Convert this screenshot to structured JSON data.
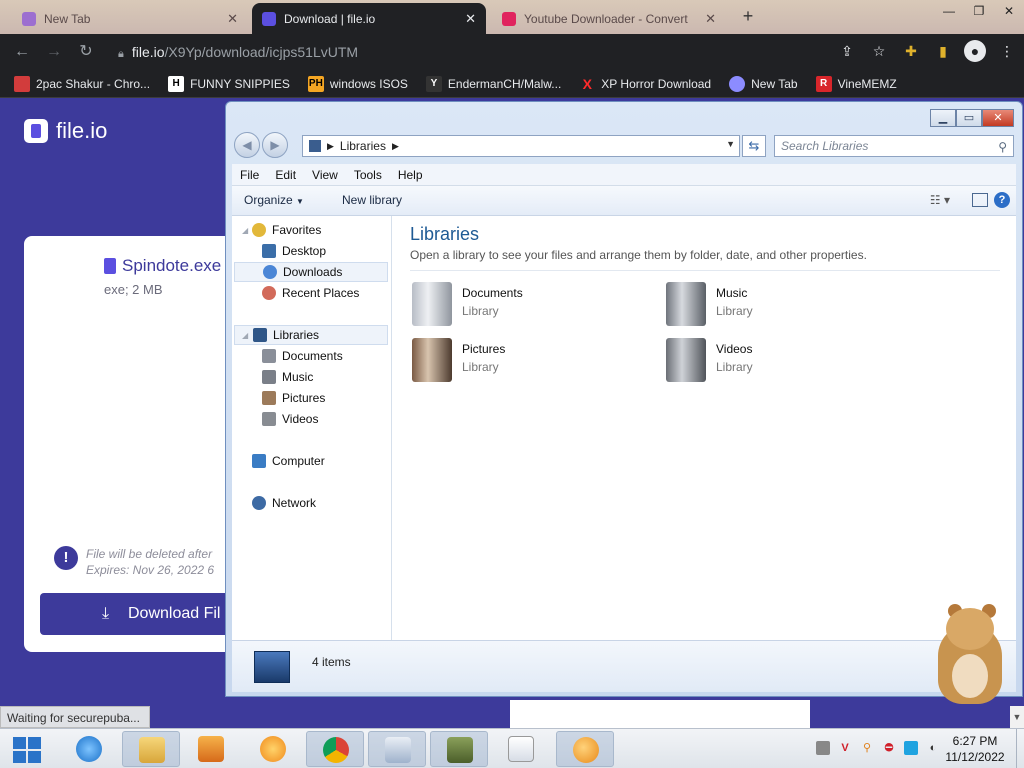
{
  "browser": {
    "tabs": [
      {
        "title": "New Tab",
        "favicon_color": "#9c6fd0"
      },
      {
        "title": "Download | file.io",
        "favicon_color": "#5b4fe0"
      },
      {
        "title": "Youtube Downloader - Convert",
        "favicon_color": "#e0245e"
      }
    ],
    "new_tab_label": "+",
    "url_host": "file.io",
    "url_path": "/X9Yp/download/icjps51LvUTM",
    "bookmarks": [
      {
        "label": "2pac Shakur - Chro...",
        "icon_text": "",
        "color": "#d23c3c"
      },
      {
        "label": "FUNNY SNIPPIES",
        "icon_text": "H",
        "color": "#ffffff"
      },
      {
        "label": "windows ISOS",
        "icon_text": "PH",
        "color": "#f5a623"
      },
      {
        "label": "EndermanCH/Malw...",
        "icon_text": "Y",
        "color": "#333333"
      },
      {
        "label": "XP Horror Download",
        "icon_text": "X",
        "color": "#ff2b2b"
      },
      {
        "label": "New Tab",
        "icon_text": "",
        "color": "#8c8cff"
      },
      {
        "label": "VineMEMZ",
        "icon_text": "R",
        "color": "#d8262b"
      }
    ],
    "status_text": "Waiting for securepuba..."
  },
  "fileio": {
    "brand": "file.io",
    "file_name": "Spindote.exe",
    "file_meta": "exe; 2 MB",
    "warning_line1": "File will be deleted after",
    "warning_line2": "Expires: Nov 26, 2022 6",
    "download_label": "Download Fil"
  },
  "explorer": {
    "address_root": "Libraries",
    "search_placeholder": "Search Libraries",
    "menu": [
      "File",
      "Edit",
      "View",
      "Tools",
      "Help"
    ],
    "toolbar": {
      "organize": "Organize",
      "new_library": "New library"
    },
    "nav": {
      "favorites": "Favorites",
      "desktop": "Desktop",
      "downloads": "Downloads",
      "recent": "Recent Places",
      "libraries": "Libraries",
      "documents": "Documents",
      "music": "Music",
      "pictures": "Pictures",
      "videos": "Videos",
      "computer": "Computer",
      "network": "Network"
    },
    "content": {
      "title": "Libraries",
      "subtitle": "Open a library to see your files and arrange them by folder, date, and other properties.",
      "items": [
        {
          "name": "Documents",
          "type": "Library"
        },
        {
          "name": "Music",
          "type": "Library"
        },
        {
          "name": "Pictures",
          "type": "Library"
        },
        {
          "name": "Videos",
          "type": "Library"
        }
      ]
    },
    "details_count": "4 items"
  },
  "taskbar": {
    "time": "6:27 PM",
    "date": "11/12/2022"
  }
}
